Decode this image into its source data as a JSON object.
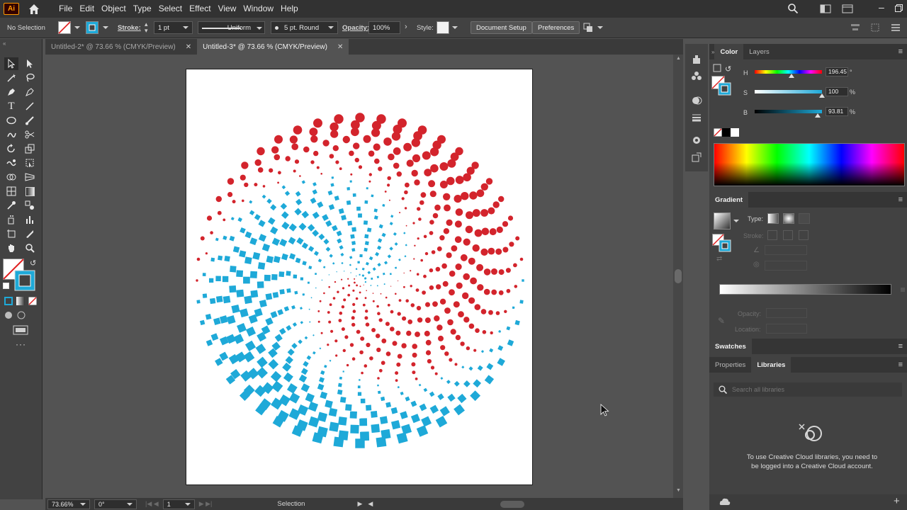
{
  "app": {
    "logo": "Ai"
  },
  "menu": [
    "File",
    "Edit",
    "Object",
    "Type",
    "Select",
    "Effect",
    "View",
    "Window",
    "Help"
  ],
  "control": {
    "selection": "No Selection",
    "stroke_label": "Stroke:",
    "stroke_value": "1 pt",
    "profile": "Uniform",
    "brush": "5 pt. Round",
    "opacity_label": "Opacity:",
    "opacity_value": "100%",
    "style_label": "Style:",
    "doc_setup": "Document Setup",
    "preferences": "Preferences"
  },
  "tabs": [
    {
      "label": "Untitled-2* @ 73.66 % (CMYK/Preview)",
      "active": false
    },
    {
      "label": "Untitled-3* @ 73.66 % (CMYK/Preview)",
      "active": true
    }
  ],
  "color_panel": {
    "tabs": [
      "Color",
      "Layers"
    ],
    "h_label": "H",
    "h_value": "196.45",
    "h_unit": "°",
    "h_level": 0.55,
    "s_label": "S",
    "s_value": "100",
    "s_unit": "%",
    "s_level": 1.0,
    "b_label": "B",
    "b_value": "93.81",
    "b_unit": "%",
    "b_level": 0.94
  },
  "gradient_panel": {
    "title": "Gradient",
    "type_label": "Type:",
    "stroke_label": "Stroke:",
    "opacity_label": "Opacity:",
    "location_label": "Location:"
  },
  "swatches": {
    "title": "Swatches"
  },
  "libraries": {
    "tabs": [
      "Properties",
      "Libraries"
    ],
    "search_placeholder": "Search all libraries",
    "message": "To use Creative Cloud libraries, you need to be logged into a Creative Cloud account."
  },
  "status": {
    "zoom": "73.66%",
    "rotation": "0°",
    "artboard": "1",
    "tool": "Selection"
  },
  "colors": {
    "red": "#d3242c",
    "blue": "#1ea9d8",
    "accent": "#1ea9d8"
  }
}
